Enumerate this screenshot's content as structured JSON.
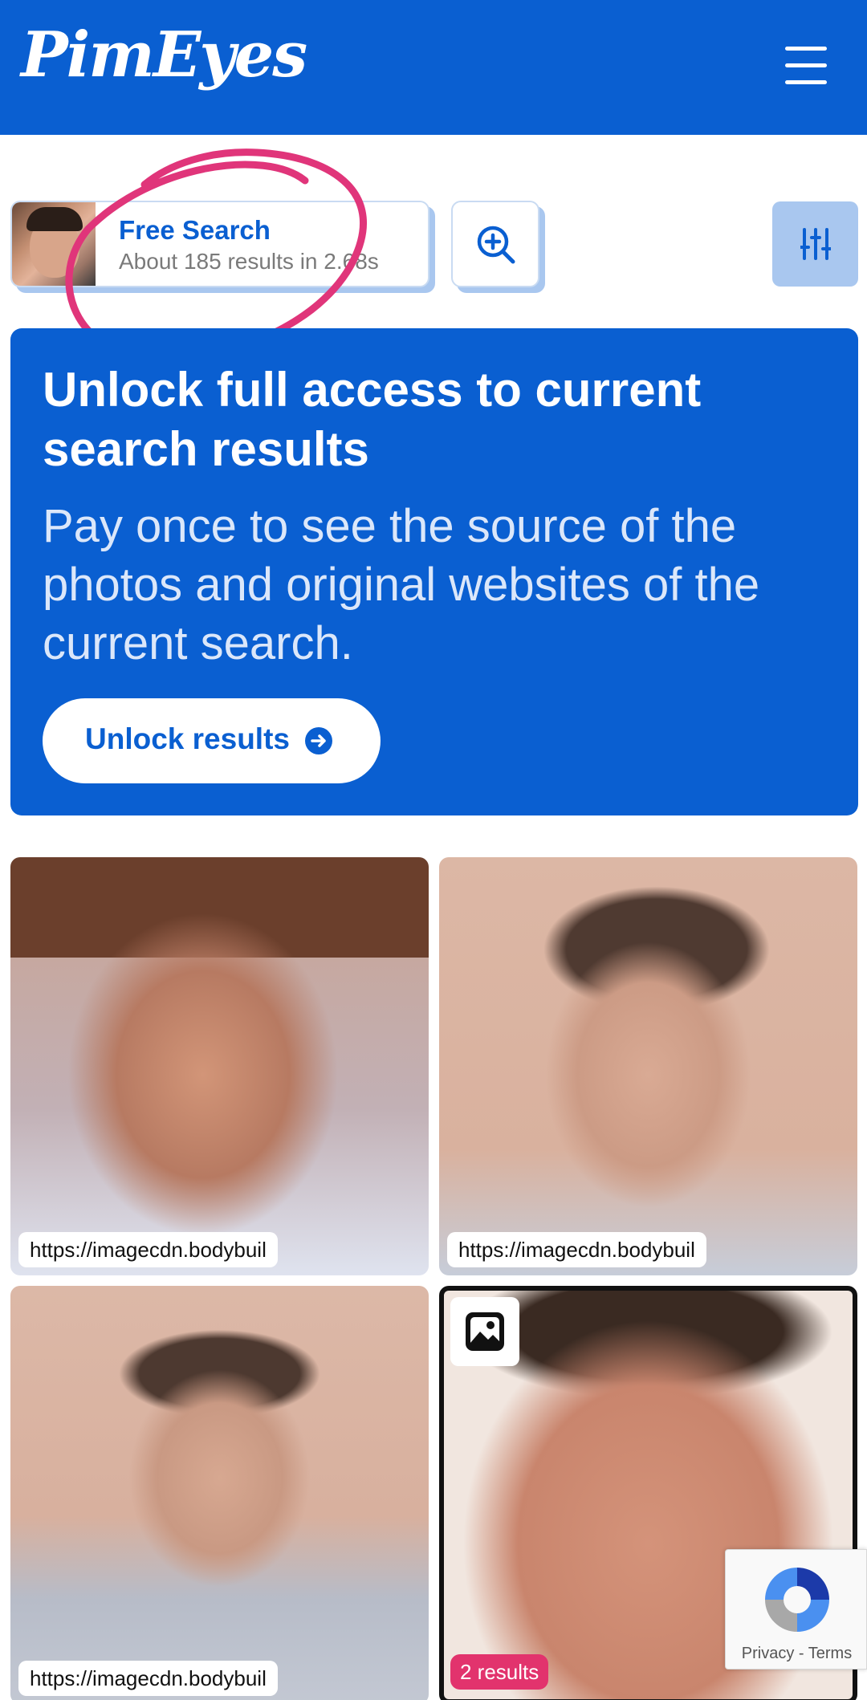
{
  "header": {
    "logo_text": "PimEyes",
    "background_color": "#0a5fd1"
  },
  "search": {
    "title": "Free Search",
    "subtitle": "About 185 results in 2.68s",
    "zoom_icon": "zoom-in-icon",
    "filter_icon": "sliders-icon"
  },
  "banner": {
    "title": "Unlock full access to current search results",
    "text": "Pay once to see the source of the photos and original websites of the current search.",
    "button_label": "Unlock results"
  },
  "results": [
    {
      "url": "https://imagecdn.bodybuil"
    },
    {
      "url": "https://imagecdn.bodybuil"
    },
    {
      "url": "https://imagecdn.bodybuil"
    },
    {
      "count_label": "2 results",
      "badge_icon": "image-icon"
    }
  ],
  "recaptcha": {
    "privacy": "Privacy",
    "separator": " - ",
    "terms": "Terms"
  },
  "colors": {
    "brand_blue": "#0a5fd1",
    "annotation_pink": "#e0357a",
    "results_badge": "#e2336d"
  }
}
